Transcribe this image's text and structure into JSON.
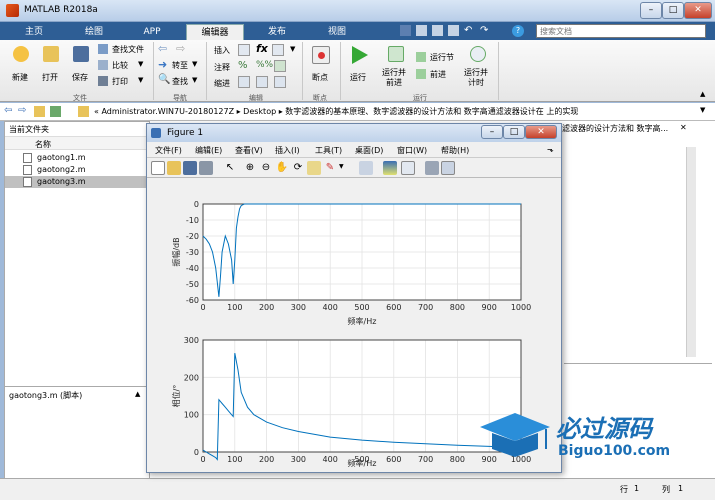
{
  "window": {
    "title": "MATLAB R2018a"
  },
  "tabs": [
    "主页",
    "绘图",
    "APP",
    "编辑器",
    "发布",
    "视图"
  ],
  "search": {
    "placeholder": "搜索文档"
  },
  "ribbon": {
    "file": {
      "new": "新建",
      "open": "打开",
      "save": "保存",
      "find_files": "查找文件",
      "compare": "比较",
      "print": "打印",
      "group": "文件"
    },
    "navigate": {
      "goto": "转至",
      "find": "查找",
      "group": "导航"
    },
    "edit": {
      "insert": "插入",
      "comment": "注释",
      "indent": "缩进",
      "group": "编辑"
    },
    "breakpoints": {
      "label": "断点",
      "group": "断点"
    },
    "run": {
      "run": "运行",
      "run_advance": "运行并\n前进",
      "run_section": "运行节",
      "advance": "前进",
      "run_time": "运行并\n计时",
      "group": "运行"
    }
  },
  "address": {
    "path": "« Administrator.WIN7U-20180127Z ▸ Desktop ▸ 数字滤波器的基本原理、数字滤波器的设计方法和 数字高通滤波器设计在 上的实现"
  },
  "file_browser": {
    "header": "当前文件夹",
    "col_name": "名称",
    "files": [
      "gaotong1.m",
      "gaotong2.m",
      "gaotong3.m"
    ],
    "selected": "gaotong3.m",
    "details": "gaotong3.m (脚本)"
  },
  "right_header": "滤波器的设计方法和 数字高...",
  "figure": {
    "title": "Figure 1",
    "menu": [
      "文件(F)",
      "编辑(E)",
      "查看(V)",
      "插入(I)",
      "工具(T)",
      "桌面(D)",
      "窗口(W)",
      "帮助(H)"
    ]
  },
  "statusbar": {
    "row_label": "行",
    "row": "1",
    "col_label": "列",
    "col": "1"
  },
  "watermark": {
    "name": "必过源码",
    "url": "Biguo100.com"
  },
  "chart_data": [
    {
      "type": "line",
      "xlabel": "频率/Hz",
      "ylabel": "振幅/dB",
      "xlim": [
        0,
        1000
      ],
      "ylim": [
        -60,
        0
      ],
      "xticks": [
        0,
        100,
        200,
        300,
        400,
        500,
        600,
        700,
        800,
        900,
        1000
      ],
      "yticks": [
        -60,
        -50,
        -40,
        -30,
        -20,
        -10,
        0
      ],
      "color": "#0072bd",
      "x": [
        0,
        10,
        20,
        30,
        40,
        50,
        55,
        60,
        70,
        80,
        90,
        95,
        100,
        105,
        110,
        115,
        120,
        130,
        150,
        200,
        300,
        500,
        1000
      ],
      "y": [
        -20,
        -22,
        -25,
        -30,
        -40,
        -58,
        -45,
        -30,
        -20,
        -25,
        -35,
        -50,
        -35,
        -15,
        -8,
        -3,
        -1,
        0,
        0,
        0,
        0,
        0,
        0
      ]
    },
    {
      "type": "line",
      "xlabel": "频率/Hz",
      "ylabel": "相位/°",
      "xlim": [
        0,
        1000
      ],
      "ylim": [
        0,
        300
      ],
      "xticks": [
        0,
        100,
        200,
        300,
        400,
        500,
        600,
        700,
        800,
        900,
        1000
      ],
      "yticks": [
        0,
        100,
        200,
        300
      ],
      "color": "#0072bd",
      "x": [
        0,
        10,
        20,
        30,
        40,
        45,
        50,
        55,
        60,
        70,
        80,
        90,
        95,
        100,
        110,
        120,
        140,
        160,
        200,
        250,
        300,
        400,
        500,
        600,
        700,
        800,
        900,
        1000
      ],
      "y": [
        5,
        0,
        -5,
        -10,
        -15,
        -20,
        140,
        135,
        130,
        120,
        110,
        100,
        95,
        265,
        220,
        160,
        120,
        100,
        80,
        65,
        55,
        40,
        32,
        26,
        22,
        18,
        15,
        12
      ]
    }
  ]
}
